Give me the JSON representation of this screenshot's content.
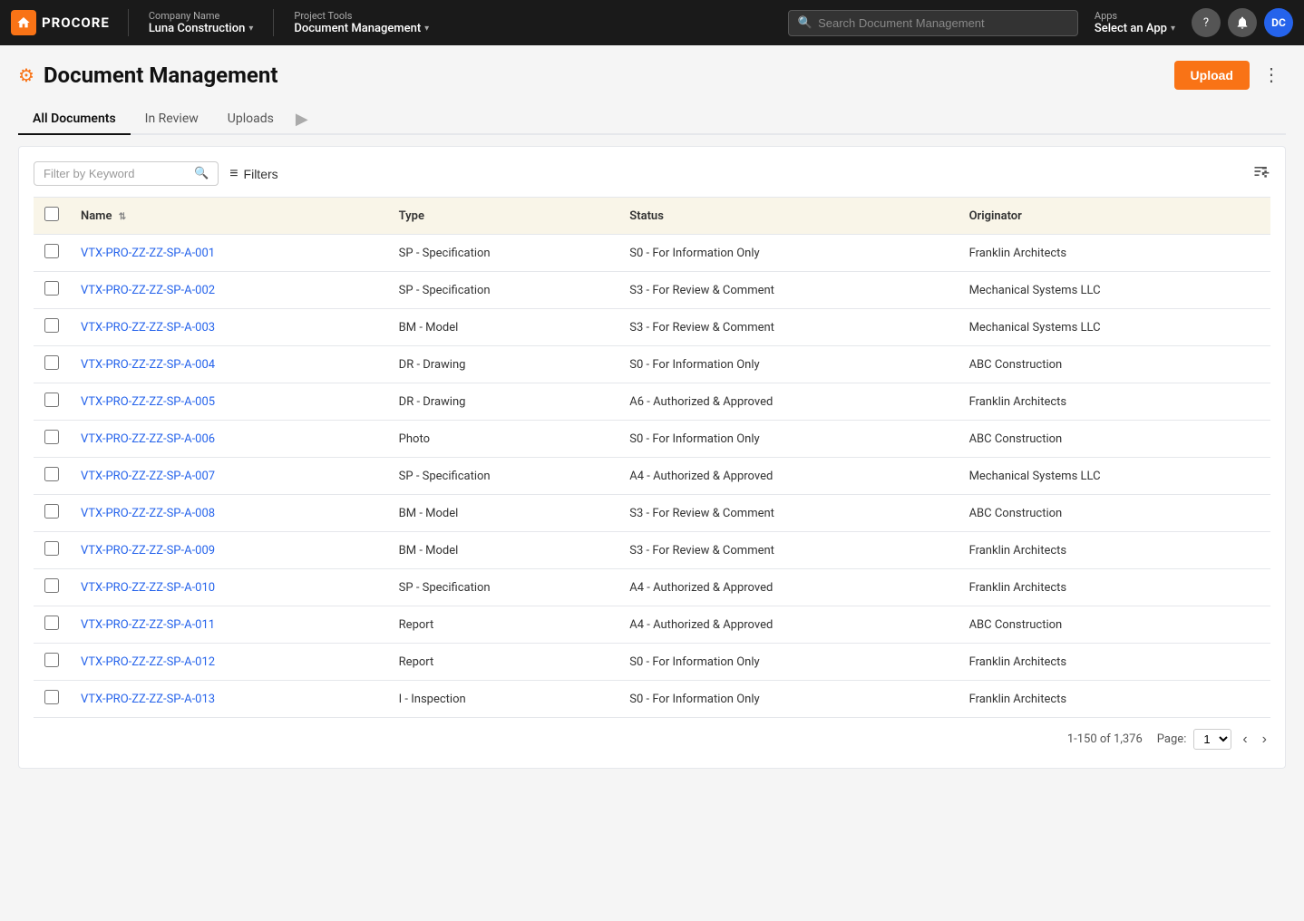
{
  "topbar": {
    "logo_text": "PROCORE",
    "company_label": "Company Name",
    "company_name": "Luna Construction",
    "project_label": "Project Tools",
    "project_name": "Document Management",
    "search_placeholder": "Search Document Management",
    "apps_label": "Apps",
    "apps_value": "Select an App",
    "help_icon": "?",
    "avatar_initials": "DC"
  },
  "page": {
    "title": "Document Management",
    "upload_label": "Upload"
  },
  "tabs": [
    {
      "id": "all-documents",
      "label": "All Documents",
      "active": true
    },
    {
      "id": "in-review",
      "label": "In Review",
      "active": false
    },
    {
      "id": "uploads",
      "label": "Uploads",
      "active": false
    }
  ],
  "toolbar": {
    "filter_placeholder": "Filter by Keyword",
    "filters_label": "Filters"
  },
  "table": {
    "columns": [
      {
        "id": "name",
        "label": "Name",
        "sortable": true
      },
      {
        "id": "type",
        "label": "Type",
        "sortable": false
      },
      {
        "id": "status",
        "label": "Status",
        "sortable": false
      },
      {
        "id": "originator",
        "label": "Originator",
        "sortable": false
      }
    ],
    "rows": [
      {
        "name": "VTX-PRO-ZZ-ZZ-SP-A-001",
        "type": "SP - Specification",
        "status": "S0 - For Information Only",
        "originator": "Franklin Architects"
      },
      {
        "name": "VTX-PRO-ZZ-ZZ-SP-A-002",
        "type": "SP - Specification",
        "status": "S3 - For Review & Comment",
        "originator": "Mechanical Systems LLC"
      },
      {
        "name": "VTX-PRO-ZZ-ZZ-SP-A-003",
        "type": "BM - Model",
        "status": "S3 - For Review & Comment",
        "originator": "Mechanical Systems LLC"
      },
      {
        "name": "VTX-PRO-ZZ-ZZ-SP-A-004",
        "type": "DR - Drawing",
        "status": "S0 - For Information Only",
        "originator": "ABC Construction"
      },
      {
        "name": "VTX-PRO-ZZ-ZZ-SP-A-005",
        "type": "DR - Drawing",
        "status": "A6 - Authorized & Approved",
        "originator": "Franklin Architects"
      },
      {
        "name": "VTX-PRO-ZZ-ZZ-SP-A-006",
        "type": "Photo",
        "status": "S0 - For Information Only",
        "originator": "ABC Construction"
      },
      {
        "name": "VTX-PRO-ZZ-ZZ-SP-A-007",
        "type": "SP - Specification",
        "status": "A4 - Authorized & Approved",
        "originator": "Mechanical Systems LLC"
      },
      {
        "name": "VTX-PRO-ZZ-ZZ-SP-A-008",
        "type": "BM - Model",
        "status": "S3 - For Review & Comment",
        "originator": "ABC Construction"
      },
      {
        "name": "VTX-PRO-ZZ-ZZ-SP-A-009",
        "type": "BM - Model",
        "status": "S3 - For Review & Comment",
        "originator": "Franklin Architects"
      },
      {
        "name": "VTX-PRO-ZZ-ZZ-SP-A-010",
        "type": "SP - Specification",
        "status": "A4 - Authorized & Approved",
        "originator": "Franklin Architects"
      },
      {
        "name": "VTX-PRO-ZZ-ZZ-SP-A-011",
        "type": "Report",
        "status": "A4 - Authorized & Approved",
        "originator": "ABC Construction"
      },
      {
        "name": "VTX-PRO-ZZ-ZZ-SP-A-012",
        "type": "Report",
        "status": "S0 - For Information Only",
        "originator": "Franklin Architects"
      },
      {
        "name": "VTX-PRO-ZZ-ZZ-SP-A-013",
        "type": "I - Inspection",
        "status": "S0 - For Information Only",
        "originator": "Franklin Architects"
      }
    ]
  },
  "pagination": {
    "range": "1-150 of 1,376",
    "page_label": "Page:",
    "current_page": "1"
  }
}
